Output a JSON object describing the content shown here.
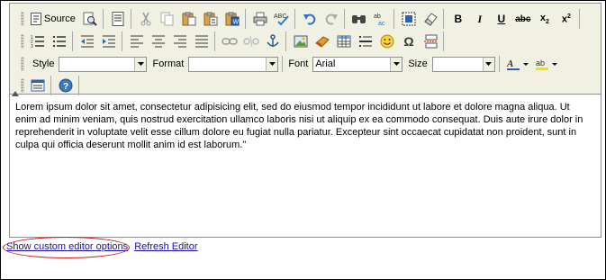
{
  "toolbar": {
    "source_label": "Source",
    "style_label": "Style",
    "style_value": "",
    "format_label": "Format",
    "format_value": "",
    "font_label": "Font",
    "font_value": "Arial",
    "size_label": "Size",
    "size_value": ""
  },
  "editor_content": "Lorem ipsum dolor sit amet, consectetur adipisicing elit, sed do eiusmod tempor incididunt ut labore et dolore magna aliqua. Ut enim ad minim veniam, quis nostrud exercitation ullamco laboris nisi ut aliquip ex ea commodo consequat. Duis aute irure dolor in reprehenderit in voluptate velit esse cillum dolore eu fugiat nulla pariatur. Excepteur sint occaecat cupidatat non proident, sunt in culpa qui officia deserunt mollit anim id est laborum.\"",
  "links": {
    "custom_options": "Show custom editor options",
    "refresh": "Refresh Editor"
  },
  "colors": {
    "toolbar_bg": "#f1f1e3",
    "link": "#1a0dab",
    "highlight": "#d01818"
  }
}
